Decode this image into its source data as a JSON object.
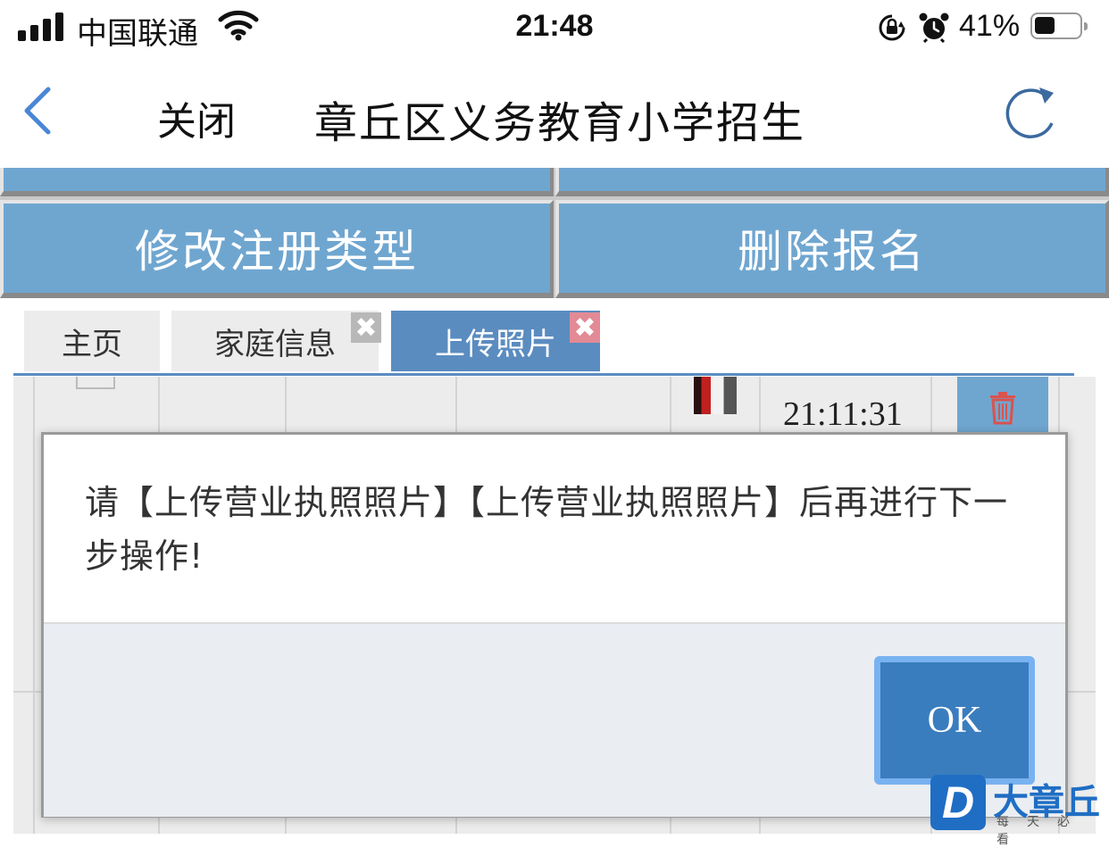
{
  "status_bar": {
    "carrier": "中国联通",
    "time": "21:48",
    "battery_percent": "41%",
    "battery_level": 0.41,
    "icons": [
      "signal-icon",
      "wifi-icon",
      "rotation-lock-icon",
      "alarm-icon",
      "battery-icon"
    ]
  },
  "nav": {
    "back_icon": "chevron-left-icon",
    "close_label": "关闭",
    "title": "章丘区义务教育小学招生",
    "refresh_icon": "refresh-icon"
  },
  "actions": {
    "modify_type_label": "修改注册类型",
    "delete_signup_label": "删除报名"
  },
  "tabs": [
    {
      "label": "主页",
      "closable": false,
      "active": false
    },
    {
      "label": "家庭信息",
      "closable": true,
      "active": false
    },
    {
      "label": "上传照片",
      "closable": true,
      "active": true
    }
  ],
  "tab_close_glyph": "✖",
  "table": {
    "row_time": "21:11:31",
    "row_action_icon": "trash-icon"
  },
  "dialog": {
    "message": "请【上传营业执照照片】【上传营业执照照片】后再进行下一步操作!",
    "ok_label": "OK"
  },
  "watermark": {
    "logo_letter": "D",
    "name": "大章丘",
    "slogan": "每天必看"
  },
  "colors": {
    "button_blue": "#6fa6d0",
    "tab_active": "#5b8cc0",
    "ok_blue": "#3a7dbe",
    "nav_icon": "#4a86d6"
  }
}
